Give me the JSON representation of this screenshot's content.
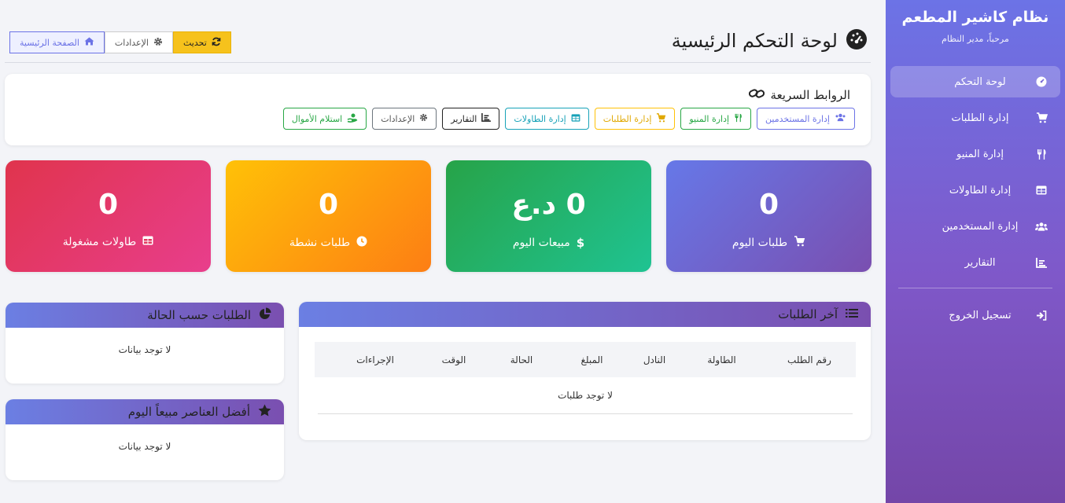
{
  "sidebar": {
    "brand_title": "نظام كاشير المطعم",
    "welcome": "مرحباً، مدير النظام",
    "items": [
      {
        "label": "لوحة التحكم",
        "icon": "gauge-icon"
      },
      {
        "label": "إدارة الطلبات",
        "icon": "cart-icon"
      },
      {
        "label": "إدارة المنيو",
        "icon": "utensils-icon"
      },
      {
        "label": "إدارة الطاولات",
        "icon": "table-icon"
      },
      {
        "label": "إدارة المستخدمين",
        "icon": "users-icon"
      },
      {
        "label": "التقارير",
        "icon": "chart-icon"
      }
    ],
    "logout": "تسجيل الخروج"
  },
  "header": {
    "title": "لوحة التحكم الرئيسية",
    "breadcrumb": {
      "home": "الصفحة الرئيسية",
      "settings": "الإعدادات",
      "refresh": "تحديث"
    }
  },
  "quick_links": {
    "title": "الروابط السريعة",
    "links": [
      {
        "label": "إدارة المستخدمين",
        "color": "#6c73e6"
      },
      {
        "label": "إدارة المنيو",
        "color": "#28a745"
      },
      {
        "label": "إدارة الطلبات",
        "color": "#ffc107"
      },
      {
        "label": "إدارة الطاولات",
        "color": "#17a2b8"
      },
      {
        "label": "التقارير",
        "color": "#222222"
      },
      {
        "label": "الإعدادات",
        "color": "#6c757d"
      },
      {
        "label": "استلام الأموال",
        "color": "#28a745"
      }
    ]
  },
  "stats": {
    "today_orders": {
      "value": "0",
      "label": "طلبات اليوم"
    },
    "today_sales": {
      "value": "0 د.ع",
      "label": "مبيعات اليوم"
    },
    "active_orders": {
      "value": "0",
      "label": "طلبات نشطة"
    },
    "occupied_tables": {
      "value": "0",
      "label": "طاولات مشغولة"
    }
  },
  "recent_orders": {
    "title": "آخر الطلبات",
    "columns": [
      "رقم الطلب",
      "الطاولة",
      "النادل",
      "المبلغ",
      "الحالة",
      "الوقت",
      "الإجراءات"
    ],
    "empty": "لا توجد طلبات"
  },
  "orders_by_status": {
    "title": "الطلبات حسب الحالة",
    "empty": "لا توجد بيانات"
  },
  "best_sellers": {
    "title": "أفضل العناصر مبيعاً اليوم",
    "empty": "لا توجد بيانات"
  }
}
